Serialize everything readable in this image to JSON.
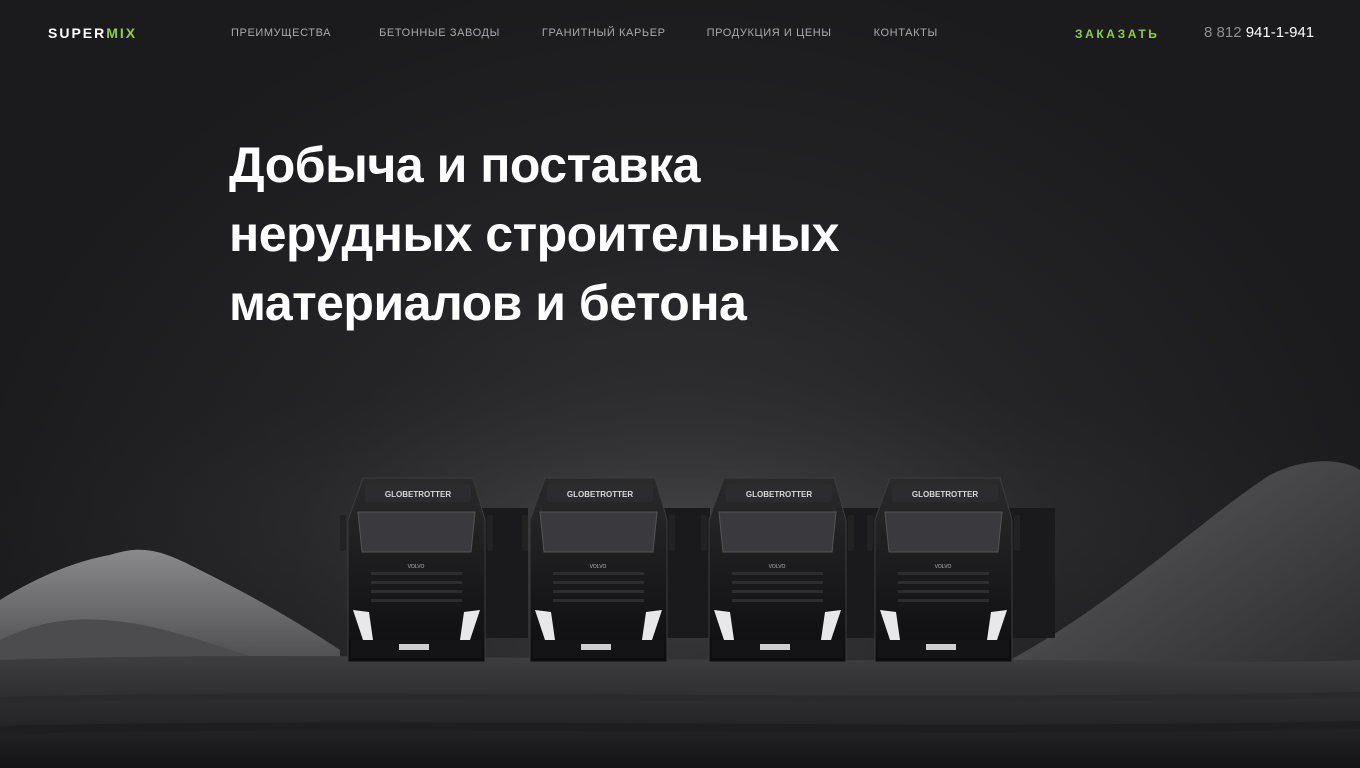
{
  "logo": {
    "part1": "SUPER",
    "part2": "MIX"
  },
  "nav": [
    {
      "label": "ПРЕИМУЩЕСТВА"
    },
    {
      "label": "БЕТОННЫЕ ЗАВОДЫ"
    },
    {
      "label": "ГРАНИТНЫЙ КАРЬЕР"
    },
    {
      "label": "ПРОДУКЦИЯ И ЦЕНЫ"
    },
    {
      "label": "КОНТАКТЫ"
    }
  ],
  "order_label": "ЗАКАЗАТЬ",
  "phone": {
    "code": "8 812",
    "number": "941-1-941"
  },
  "hero": {
    "lines": [
      "Добыча и поставка",
      "нерудных строительных",
      "материалов и бетона"
    ]
  },
  "trucks": [
    {
      "visor": "GLOBETROTTER",
      "brand": "VOLVO"
    },
    {
      "visor": "GLOBETROTTER",
      "brand": "VOLVO"
    },
    {
      "visor": "GLOBETROTTER",
      "brand": "VOLVO"
    },
    {
      "visor": "GLOBETROTTER",
      "brand": "VOLVO"
    }
  ],
  "colors": {
    "accent": "#8ad13a",
    "background": "#1c1c1f",
    "nav_text": "#a9a9ae"
  }
}
